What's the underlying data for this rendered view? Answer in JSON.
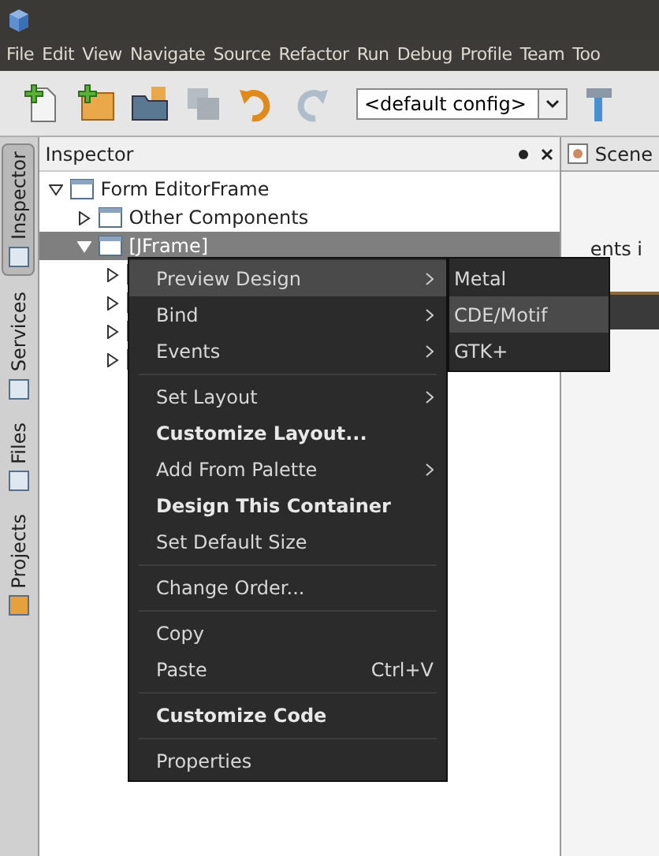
{
  "menu_bar": [
    "File",
    "Edit",
    "View",
    "Navigate",
    "Source",
    "Refactor",
    "Run",
    "Debug",
    "Profile",
    "Team",
    "Too"
  ],
  "toolbar": {
    "buttons": [
      {
        "kind": "new-file",
        "disabled": false
      },
      {
        "kind": "new-project",
        "disabled": false
      },
      {
        "kind": "open-project",
        "disabled": false
      },
      {
        "kind": "save-all",
        "disabled": true
      },
      {
        "kind": "undo",
        "disabled": false
      },
      {
        "kind": "redo",
        "disabled": true
      }
    ],
    "config": "<default config>"
  },
  "side_tabs": [
    {
      "label": "Inspector",
      "selected": true
    },
    {
      "label": "Services",
      "selected": false
    },
    {
      "label": "Files",
      "selected": false
    },
    {
      "label": "Projects",
      "selected": false
    }
  ],
  "inspector": {
    "title": "Inspector",
    "tree": [
      {
        "label": "Form EditorFrame",
        "expanded": true,
        "selected": false,
        "children": [
          {
            "label": "Other Components",
            "expanded": false,
            "selected": false
          },
          {
            "label": "[JFrame]",
            "expanded": true,
            "selected": true,
            "children": [
              {
                "expanded": false,
                "selected": false
              },
              {
                "expanded": false,
                "selected": false
              },
              {
                "expanded": false,
                "selected": false
              },
              {
                "expanded": false,
                "selected": false
              }
            ]
          }
        ]
      }
    ]
  },
  "editor": {
    "tab": "Scene",
    "text": "ents i"
  },
  "context_menu": [
    {
      "kind": "item",
      "label": "Preview Design",
      "submenu": true,
      "bold": false,
      "selected": true
    },
    {
      "kind": "item",
      "label": "Bind",
      "submenu": true,
      "bold": false,
      "selected": false
    },
    {
      "kind": "item",
      "label": "Events",
      "submenu": true,
      "bold": false,
      "selected": false
    },
    {
      "kind": "separator"
    },
    {
      "kind": "item",
      "label": "Set Layout",
      "submenu": true,
      "bold": false,
      "selected": false
    },
    {
      "kind": "item",
      "label": "Customize Layout...",
      "submenu": false,
      "bold": true,
      "selected": false
    },
    {
      "kind": "item",
      "label": "Add From Palette",
      "submenu": true,
      "bold": false,
      "selected": false
    },
    {
      "kind": "item",
      "label": "Design This Container",
      "submenu": false,
      "bold": true,
      "selected": false
    },
    {
      "kind": "item",
      "label": "Set Default Size",
      "submenu": false,
      "bold": false,
      "selected": false
    },
    {
      "kind": "separator"
    },
    {
      "kind": "item",
      "label": "Change Order...",
      "submenu": false,
      "bold": false,
      "selected": false
    },
    {
      "kind": "separator"
    },
    {
      "kind": "item",
      "label": "Copy",
      "submenu": false,
      "bold": false,
      "selected": false
    },
    {
      "kind": "item",
      "label": "Paste",
      "submenu": false,
      "bold": false,
      "selected": false,
      "shortcut": "Ctrl+V"
    },
    {
      "kind": "separator"
    },
    {
      "kind": "item",
      "label": "Customize Code",
      "submenu": false,
      "bold": true,
      "selected": false
    },
    {
      "kind": "separator"
    },
    {
      "kind": "item",
      "label": "Properties",
      "submenu": false,
      "bold": false,
      "selected": false
    }
  ],
  "submenu": [
    {
      "label": "Metal",
      "selected": false
    },
    {
      "label": "CDE/Motif",
      "selected": true
    },
    {
      "label": "GTK+",
      "selected": false
    }
  ]
}
